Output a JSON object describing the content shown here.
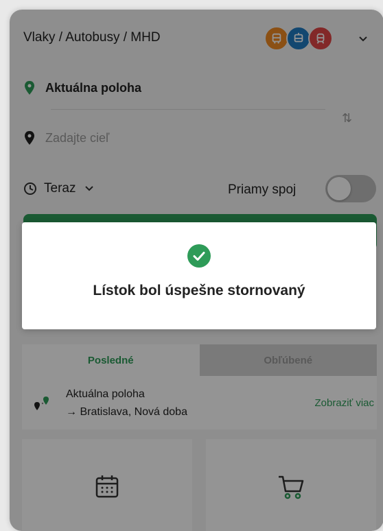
{
  "header": {
    "mode_title": "Vlaky / Autobusy / MHD"
  },
  "modes": [
    {
      "name": "bus",
      "color": "#f08a24"
    },
    {
      "name": "tram",
      "color": "#1f7bc1"
    },
    {
      "name": "train",
      "color": "#e04545"
    }
  ],
  "search": {
    "from_label": "Aktuálna poloha",
    "to_placeholder": "Zadajte cieľ",
    "swap_symbol": "⇅",
    "time_label": "Teraz",
    "direct_label": "Priamy spoj",
    "direct_enabled": false
  },
  "tabs": {
    "recent": "Posledné",
    "favorites": "Obľúbené",
    "active": "recent"
  },
  "recent_item": {
    "from": "Aktuálna poloha",
    "to": "→ Bratislava, Nová doba",
    "more_link": "Zobraziť viac"
  },
  "toast": {
    "message": "Lístok bol úspešne stornovaný"
  },
  "colors": {
    "accent": "#2e9b58",
    "overlay": "rgba(0,0,0,0.42)"
  }
}
